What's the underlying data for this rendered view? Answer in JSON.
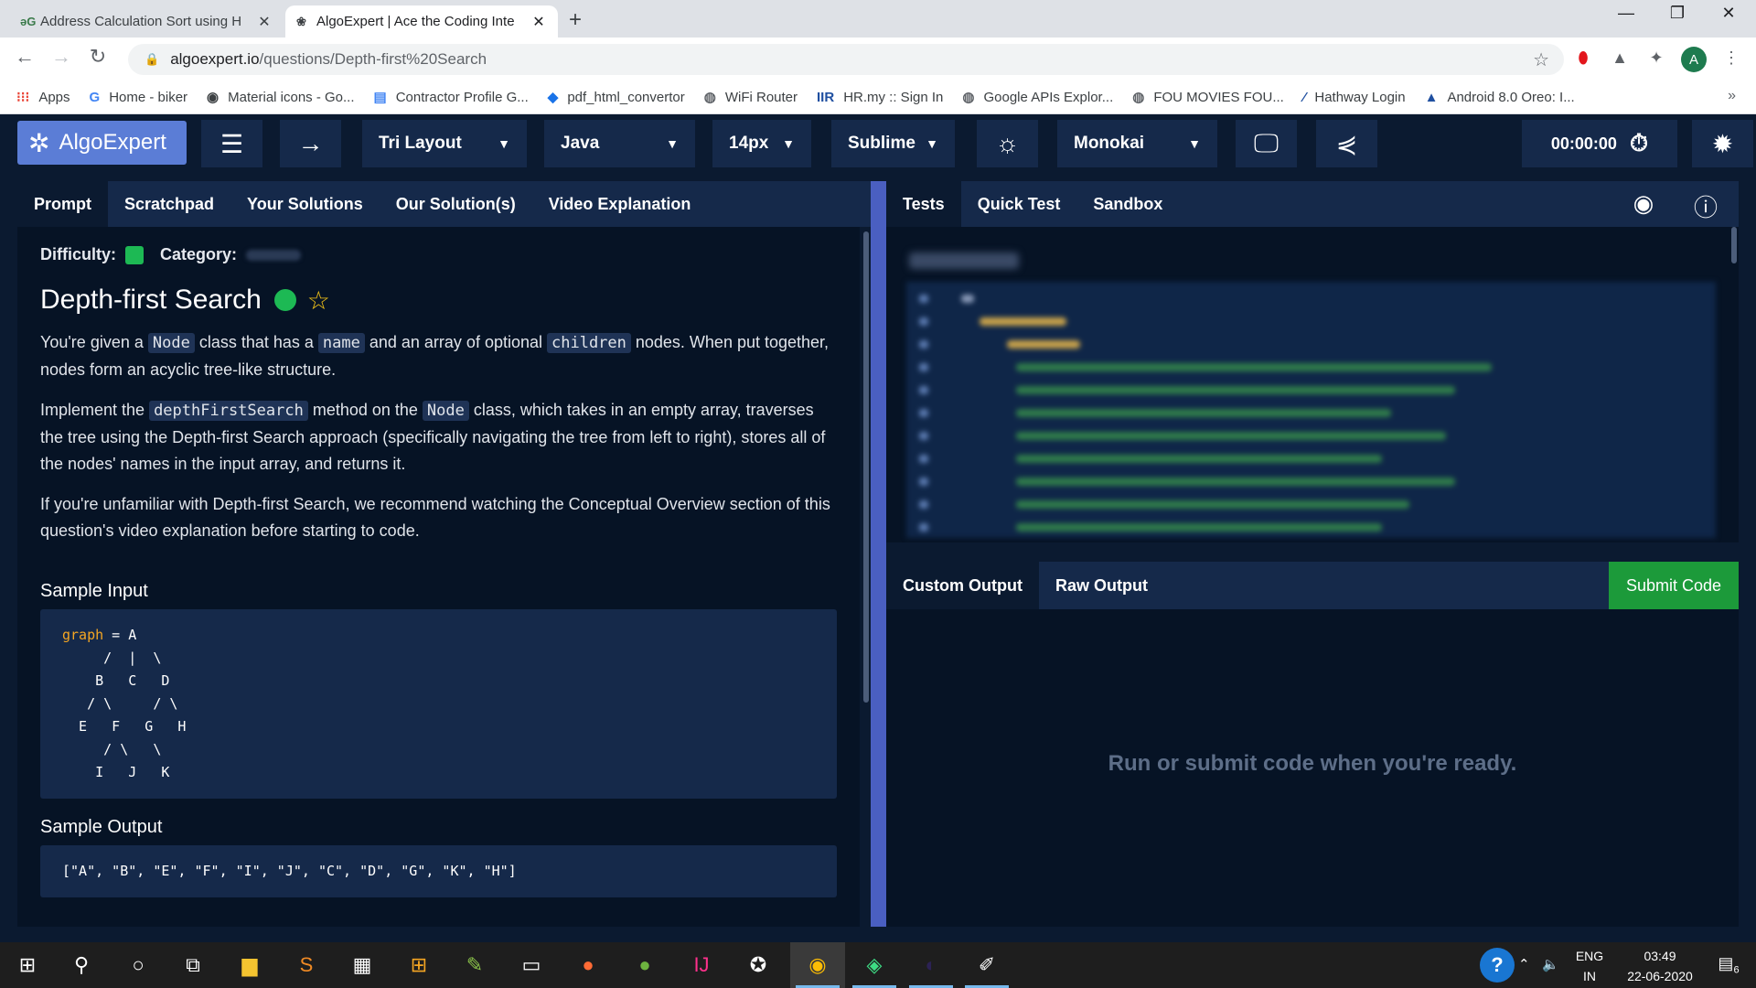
{
  "browser": {
    "tabs": [
      {
        "icon": "əG",
        "title": "Address Calculation Sort using H"
      },
      {
        "icon": "❀",
        "title": "AlgoExpert | Ace the Coding Inte"
      }
    ],
    "url_domain": "algoexpert.io",
    "url_path": "/questions/Depth-first%20Search",
    "bookmarks": [
      "Apps",
      "Home - biker",
      "Material icons - Go...",
      "Contractor Profile G...",
      "pdf_html_convertor",
      "WiFi Router",
      "HR.my :: Sign In",
      "Google APIs Explor...",
      "FOU MOVIES FOU...",
      "Hathway Login",
      "Android 8.0 Oreo: I..."
    ],
    "avatar_letter": "A",
    "more": "»"
  },
  "toolbar": {
    "logo": "AlgoExpert",
    "layout": "Tri Layout",
    "language": "Java",
    "font_size": "14px",
    "keymap": "Sublime",
    "theme": "Monokai",
    "timer": "00:00:00"
  },
  "left_tabs": [
    "Prompt",
    "Scratchpad",
    "Your Solutions",
    "Our Solution(s)",
    "Video Explanation"
  ],
  "prompt": {
    "difficulty_label": "Difficulty:",
    "category_label": "Category:",
    "title": "Depth-first Search",
    "p1_a": "You're given a ",
    "p1_code1": "Node",
    "p1_b": " class that has a ",
    "p1_code2": "name",
    "p1_c": " and an array of optional ",
    "p1_code3": "children",
    "p1_d": " nodes. When put together, nodes form an acyclic tree-like structure.",
    "p2_a": "Implement the ",
    "p2_code1": "depthFirstSearch",
    "p2_b": " method on the ",
    "p2_code2": "Node",
    "p2_c": " class, which takes in an empty array, traverses the tree using the Depth-first Search approach (specifically navigating the tree from left to right), stores all of the nodes' names in the input array, and returns it.",
    "p3": "If you're unfamiliar with Depth-first Search, we recommend watching the Conceptual Overview section of this question's video explanation before starting to code.",
    "sample_input_label": "Sample Input",
    "sample_input_var": "graph",
    "sample_input_rest": " = A\n     /  |  \\\n    B   C   D\n   / \\     / \\\n  E   F   G   H\n     / \\   \\\n    I   J   K",
    "sample_output_label": "Sample Output",
    "sample_output": "[\"A\", \"B\", \"E\", \"F\", \"I\", \"J\", \"C\", \"D\", \"G\", \"K\", \"H\"]"
  },
  "right_tabs": [
    "Tests",
    "Quick Test",
    "Sandbox"
  ],
  "output_tabs": [
    "Custom Output",
    "Raw Output"
  ],
  "submit_label": "Submit Code",
  "output_placeholder": "Run or submit code when you're ready.",
  "taskbar": {
    "lang": "ENG",
    "region": "IN",
    "time": "03:49",
    "date": "22-06-2020",
    "notif_count": "6"
  },
  "colors": {
    "accent": "#5b7dd6",
    "divider": "#4a5fc1",
    "easy_green": "#1db954",
    "submit_green": "#1c9a3a"
  }
}
